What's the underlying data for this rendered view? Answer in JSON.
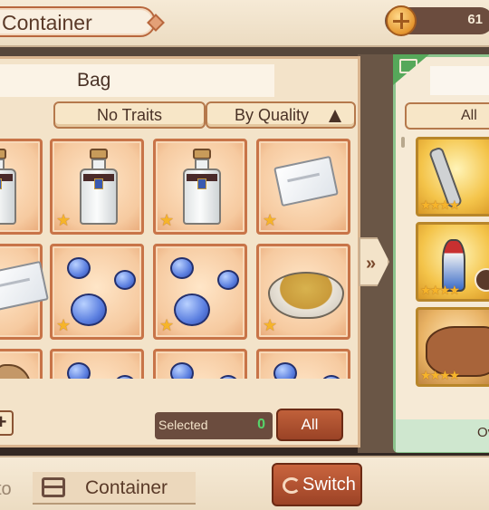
{
  "header": {
    "title": "Container",
    "currency_value": "61"
  },
  "bag": {
    "title": "Bag",
    "filter_traits": "No Traits",
    "sort_quality": "By Quality",
    "items": [
      {
        "kind": "bottle",
        "stars": "★"
      },
      {
        "kind": "bottle",
        "stars": "★"
      },
      {
        "kind": "bottle",
        "stars": "★"
      },
      {
        "kind": "cloth",
        "stars": "★"
      },
      {
        "kind": "cloth",
        "stars": ""
      },
      {
        "kind": "orbs",
        "stars": "★"
      },
      {
        "kind": "orbs",
        "stars": "★"
      },
      {
        "kind": "bowl",
        "stars": "★"
      },
      {
        "kind": "rock",
        "stars": ""
      },
      {
        "kind": "orbs",
        "stars": ""
      },
      {
        "kind": "orbs",
        "stars": ""
      },
      {
        "kind": "orbs",
        "stars": ""
      }
    ],
    "plus_label": "+",
    "selected_label": "Selected",
    "selected_count": "0",
    "all_button": "All"
  },
  "container": {
    "filter_all": "All",
    "items": [
      {
        "kind": "spear",
        "stars": "★★★★"
      },
      {
        "kind": "dress",
        "stars": "★★★★"
      },
      {
        "kind": "leather",
        "stars": "★★★★"
      }
    ],
    "bottom_label": "Ov"
  },
  "footer": {
    "to_label": "to",
    "target_label": "Container",
    "switch_label": "Switch"
  },
  "colors": {
    "accent_button": "#b04e2e",
    "slot_border": "#c87448",
    "container_border": "#8bc48d",
    "selected_count_color": "#56d46a"
  }
}
